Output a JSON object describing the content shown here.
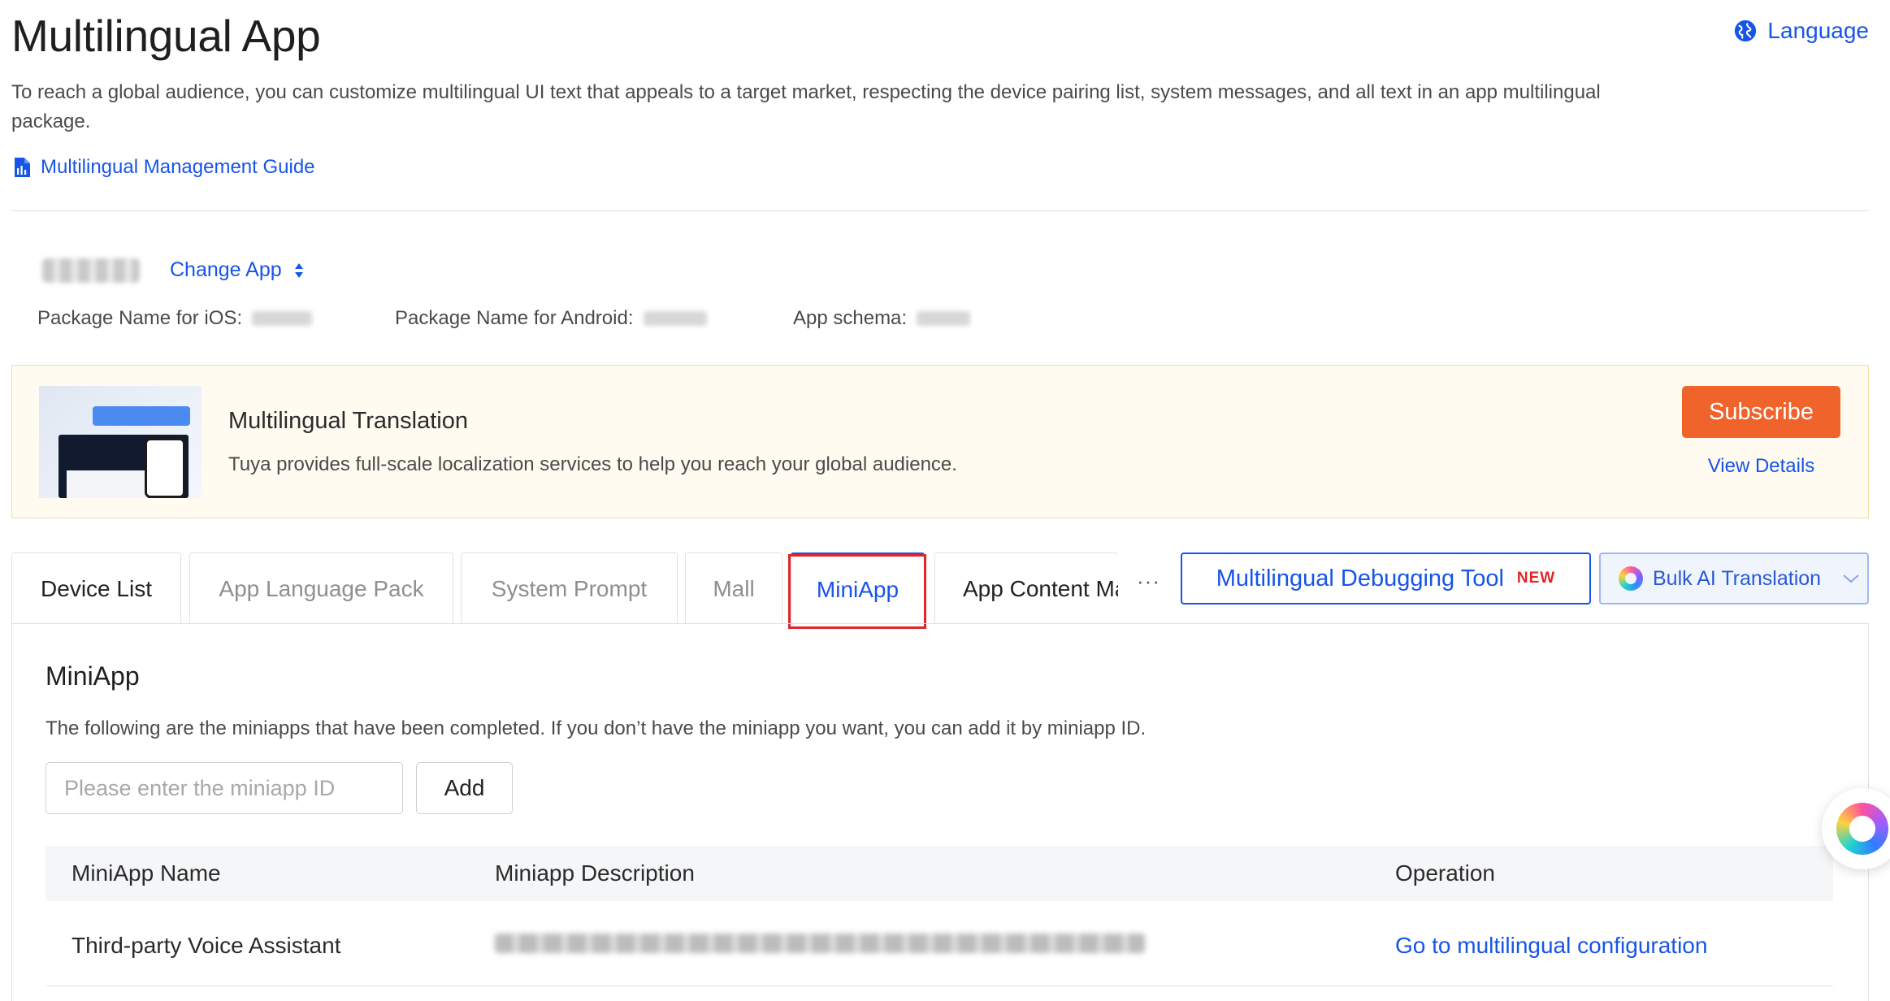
{
  "header": {
    "title": "Multilingual App",
    "language_label": "Language",
    "intro": "To reach a global audience, you can customize multilingual UI text that appeals to a target market, respecting the device pairing list, system messages, and all text in an app multilingual package.",
    "guide_link": "Multilingual Management Guide"
  },
  "app_info": {
    "change_app_label": "Change App",
    "ios_label": "Package Name for iOS:",
    "android_label": "Package Name for Android:",
    "schema_label": "App schema:"
  },
  "banner": {
    "title": "Multilingual Translation",
    "description": "Tuya provides full-scale localization services to help you reach your global audience.",
    "subscribe_label": "Subscribe",
    "view_details_label": "View Details"
  },
  "tabs": [
    {
      "label": "Device List"
    },
    {
      "label": "App Language Pack"
    },
    {
      "label": "System Prompt"
    },
    {
      "label": "Mall"
    },
    {
      "label": "MiniApp"
    },
    {
      "label": "App Content Management"
    }
  ],
  "active_tab": "MiniApp",
  "toolbar": {
    "more_label": "···",
    "debug_tool_label": "Multilingual Debugging Tool",
    "new_badge": "NEW",
    "bulk_ai_label": "Bulk AI Translation"
  },
  "miniapp": {
    "title": "MiniApp",
    "description": "The following are the miniapps that have been completed. If you don’t have the miniapp you want, you can add it by miniapp ID.",
    "input_placeholder": "Please enter the miniapp ID",
    "add_label": "Add",
    "columns": [
      "MiniApp Name",
      "Miniapp Description",
      "Operation"
    ],
    "rows": [
      {
        "name": "Third-party Voice Assistant",
        "operation": "Go to multilingual configuration"
      }
    ]
  },
  "colors": {
    "link_blue": "#1754e8",
    "subscribe_orange": "#f0632b",
    "highlight_red": "#e0262a",
    "banner_bg": "#fffbf0"
  }
}
